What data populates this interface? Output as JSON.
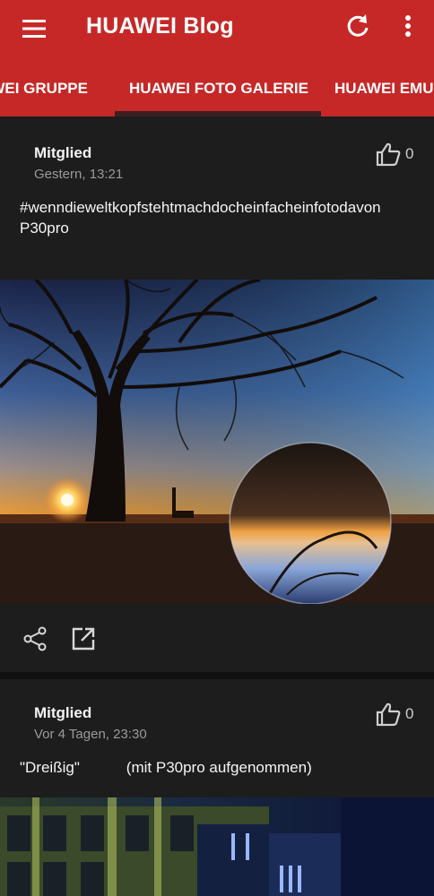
{
  "app": {
    "title": "HUAWEI Blog",
    "accent_color": "#c62828",
    "icons": [
      "menu-icon",
      "refresh-icon",
      "more-vert-icon"
    ]
  },
  "tabs": [
    {
      "label": "HUAWEI GRUPPE",
      "visible_text": "AWEI GRUPPE"
    },
    {
      "label": "HUAWEI FOTO GALERIE",
      "selected": true
    },
    {
      "label": "HUAWEI EMUI",
      "visible_text": "HUAWEI EMUI"
    }
  ],
  "posts": [
    {
      "author": "Mitglied",
      "date": "Gestern, 13:21",
      "likes": "0",
      "text_line1": "#wenndieweltkopfstehtmachdocheinfacheinfotodavon",
      "text_line2": "P30pro",
      "image": "sunset tree crystal ball",
      "actions": [
        "share-icon",
        "open-external-icon"
      ]
    },
    {
      "author": "Mitglied",
      "date": "Vor 4 Tagen, 23:30",
      "likes": "0",
      "text_line1": "\"Dreißig\"           (mit P30pro aufgenommen)",
      "image": "night building facade"
    }
  ]
}
